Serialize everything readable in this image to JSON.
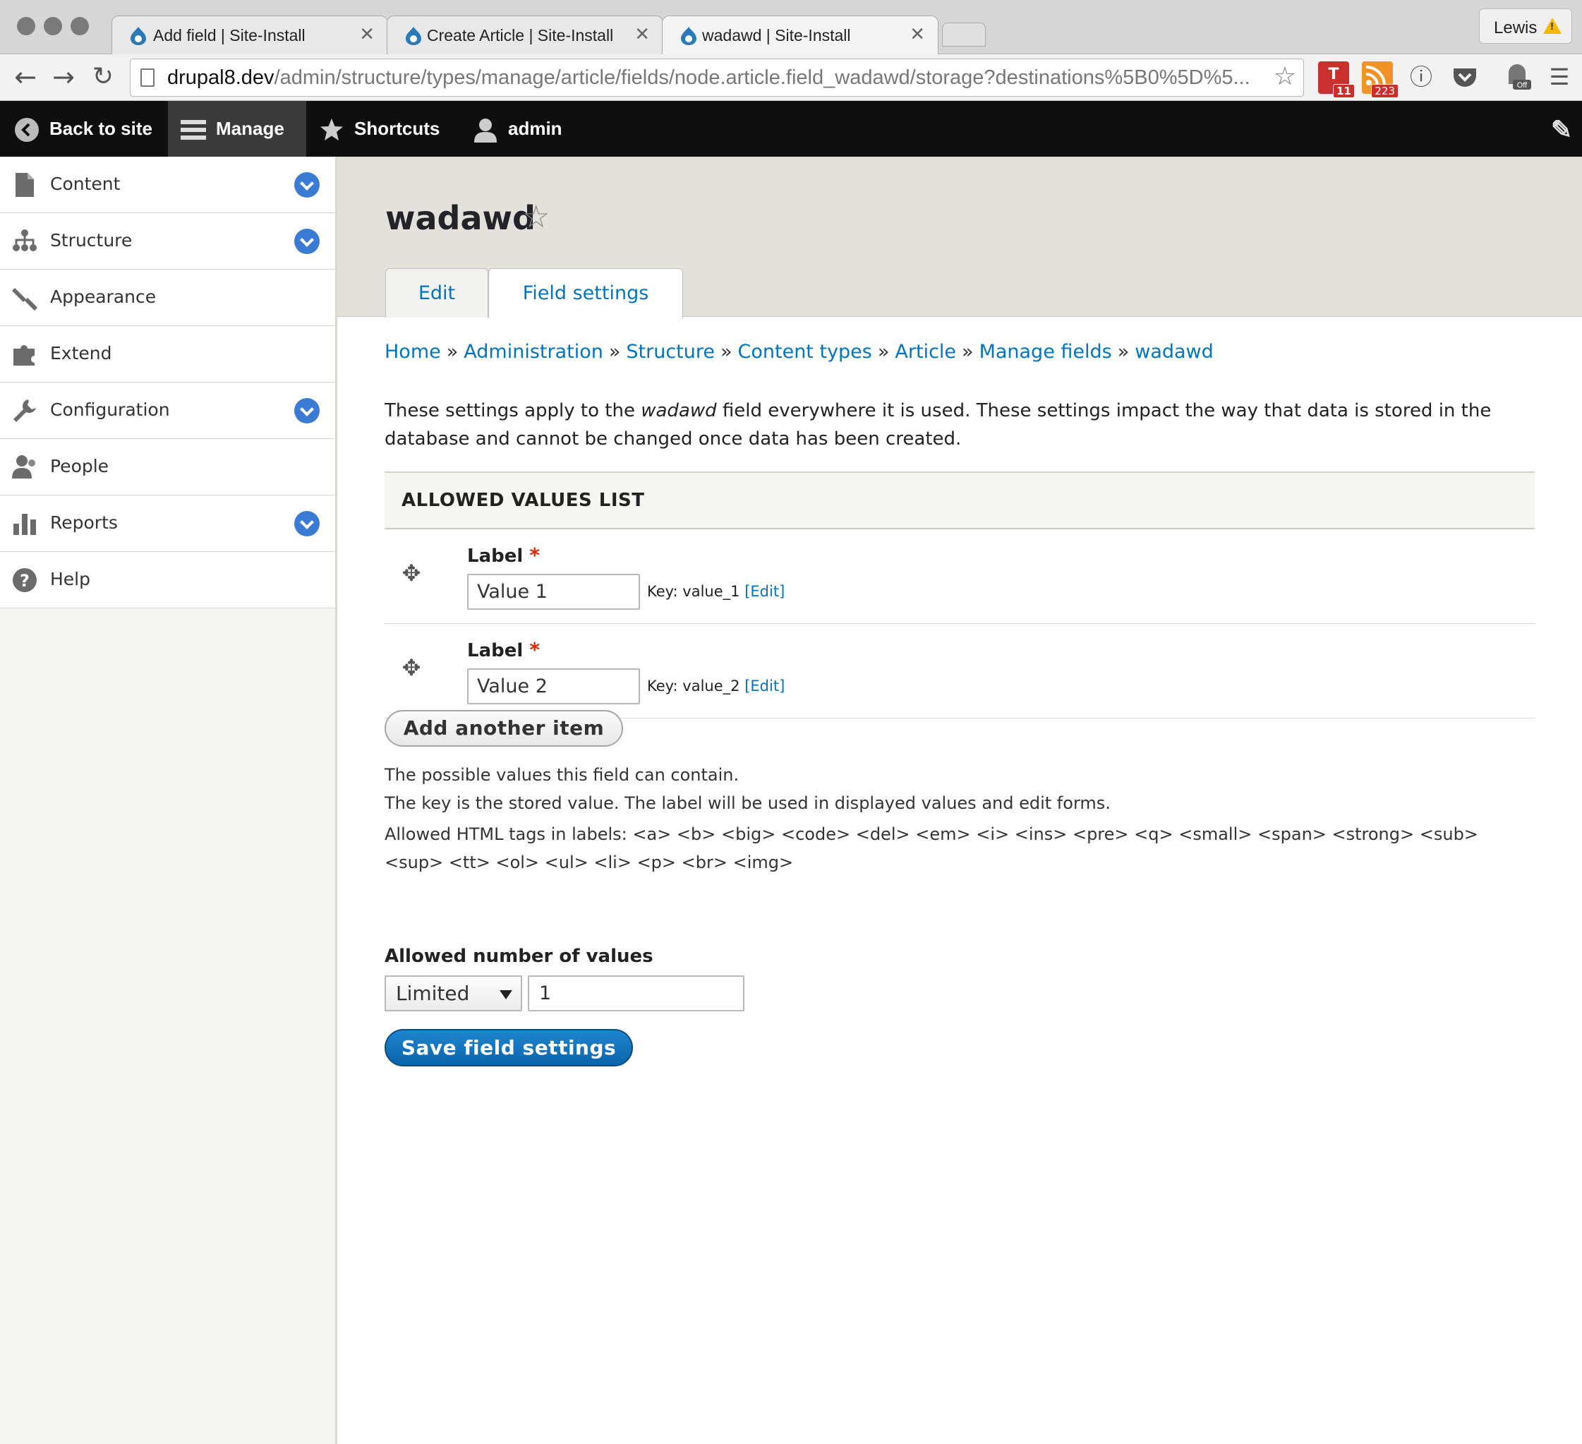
{
  "browser": {
    "tabs": [
      {
        "title": "Add field | Site-Install"
      },
      {
        "title": "Create Article | Site-Install"
      },
      {
        "title": "wadawd | Site-Install"
      }
    ],
    "profile_name": "Lewis",
    "url_host": "drupal8.dev",
    "url_path": "/admin/structure/types/manage/article/fields/node.article.field_wadawd/storage?destinations%5B0%5D%5...",
    "extensions": [
      {
        "name": "todoist",
        "badge": "11"
      },
      {
        "name": "rss",
        "badge": "223"
      },
      {
        "name": "1password"
      },
      {
        "name": "pocket"
      },
      {
        "name": "ghostery",
        "badge": "Off"
      },
      {
        "name": "menu"
      }
    ]
  },
  "toolbar": {
    "back_to_site": "Back to site",
    "manage": "Manage",
    "shortcuts": "Shortcuts",
    "user": "admin"
  },
  "sidebar": {
    "items": [
      {
        "label": "Content",
        "icon": "file-icon",
        "expandable": true
      },
      {
        "label": "Structure",
        "icon": "sitemap-icon",
        "expandable": true
      },
      {
        "label": "Appearance",
        "icon": "brush-icon",
        "expandable": false
      },
      {
        "label": "Extend",
        "icon": "puzzle-icon",
        "expandable": false
      },
      {
        "label": "Configuration",
        "icon": "wrench-icon",
        "expandable": true
      },
      {
        "label": "People",
        "icon": "people-icon",
        "expandable": false
      },
      {
        "label": "Reports",
        "icon": "bar-chart-icon",
        "expandable": true
      },
      {
        "label": "Help",
        "icon": "help-icon",
        "expandable": false
      }
    ]
  },
  "page": {
    "title": "wadawd",
    "tabs": [
      {
        "label": "Edit",
        "active": false
      },
      {
        "label": "Field settings",
        "active": true
      }
    ],
    "breadcrumb": [
      "Home",
      "Administration",
      "Structure",
      "Content types",
      "Article",
      "Manage fields",
      "wadawd"
    ],
    "breadcrumb_separator": "»",
    "intro_before": "These settings apply to the ",
    "intro_em": "wadawd",
    "intro_after": " field everywhere it is used. These settings impact the way that data is stored in the database and cannot be changed once data has been created."
  },
  "allowed_values": {
    "legend": "ALLOWED VALUES LIST",
    "rows": [
      {
        "label": "Label",
        "required_mark": "*",
        "value": "Value 1",
        "key_prefix": "Key: value_1 ",
        "key_edit": "[Edit]"
      },
      {
        "label": "Label",
        "required_mark": "*",
        "value": "Value 2",
        "key_prefix": "Key: value_2 ",
        "key_edit": "[Edit]"
      }
    ],
    "add_button": "Add another item",
    "description_line1": "The possible values this field can contain.",
    "description_line2": "The key is the stored value. The label will be used in displayed values and edit forms.",
    "allowed_html": "Allowed HTML tags in labels: <a> <b> <big> <code> <del> <em> <i> <ins> <pre> <q> <small> <span> <strong> <sub> <sup> <tt> <ol> <ul> <li> <p> <br> <img>"
  },
  "cardinality": {
    "label": "Allowed number of values",
    "select_value": "Limited",
    "number_value": "1"
  },
  "save_button": "Save field settings",
  "colors": {
    "link": "#0074bd",
    "primary_button": "#0b65ab",
    "toolbar_bg": "#0f0f0f",
    "toggle_blue": "#3a7cd3",
    "required": "#e32700"
  }
}
